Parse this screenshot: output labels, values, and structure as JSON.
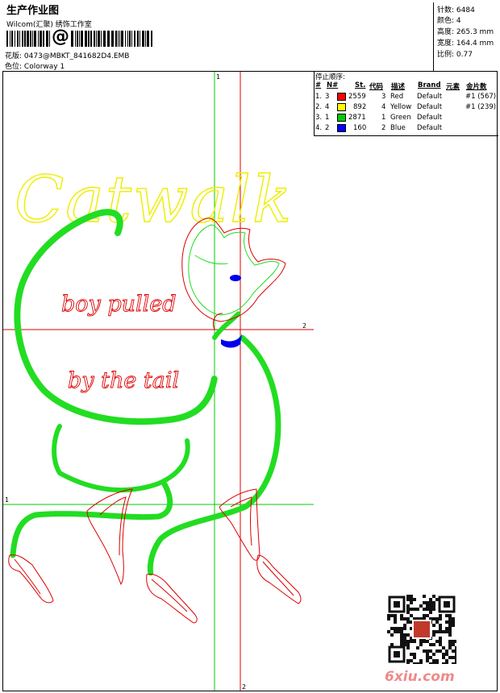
{
  "header": {
    "title": "生产作业图",
    "company": "Wilcom(汇聚) 绣饰工作室",
    "barcode_symbol": "@",
    "design_label": "花版:",
    "design_value": "0473@MBKT_841682D4.EMB",
    "colorway_label": "色位:",
    "colorway_value": "Colorway 1"
  },
  "stats": {
    "stitches_label": "针数:",
    "stitches_value": "6484",
    "colors_label": "颜色:",
    "colors_value": "4",
    "height_label": "高度:",
    "height_value": "265.3 mm",
    "width_label": "宽度:",
    "width_value": "164.4 mm",
    "scale_label": "比例:",
    "scale_value": "0.77"
  },
  "stop_sequence": {
    "title": "停止顺序:",
    "headers": [
      "#",
      "N#",
      "St.",
      "代码",
      "描述",
      "Brand",
      "元素",
      "金片数"
    ],
    "rows": [
      {
        "idx": "1.",
        "n": "3",
        "color": "#ff0000",
        "st": "2559",
        "code": "3",
        "desc": "Red",
        "brand": "Default",
        "elements": "#1 (567)"
      },
      {
        "idx": "2.",
        "n": "4",
        "color": "#ffff00",
        "st": "892",
        "code": "4",
        "desc": "Yellow",
        "brand": "Default",
        "elements": "#1 (239)"
      },
      {
        "idx": "3.",
        "n": "1",
        "color": "#00cc00",
        "st": "2871",
        "code": "1",
        "desc": "Green",
        "brand": "Default",
        "elements": ""
      },
      {
        "idx": "4.",
        "n": "2",
        "color": "#0000ff",
        "st": "160",
        "code": "2",
        "desc": "Blue",
        "brand": "Default",
        "elements": ""
      }
    ]
  },
  "canvas": {
    "guide_labels": {
      "top_vertical": "1",
      "right_horizontal": "2",
      "left_horizontal": "1",
      "bottom_vertical": "2"
    },
    "art_text": {
      "title": "Catwalk",
      "line1": "boy pulled",
      "line2": "by the tail"
    },
    "colors": {
      "green": "#22dd22",
      "red": "#dd0000",
      "yellow": "#eeee00",
      "blue": "#0000ee"
    }
  },
  "watermark": {
    "text": "6xiu.com"
  }
}
